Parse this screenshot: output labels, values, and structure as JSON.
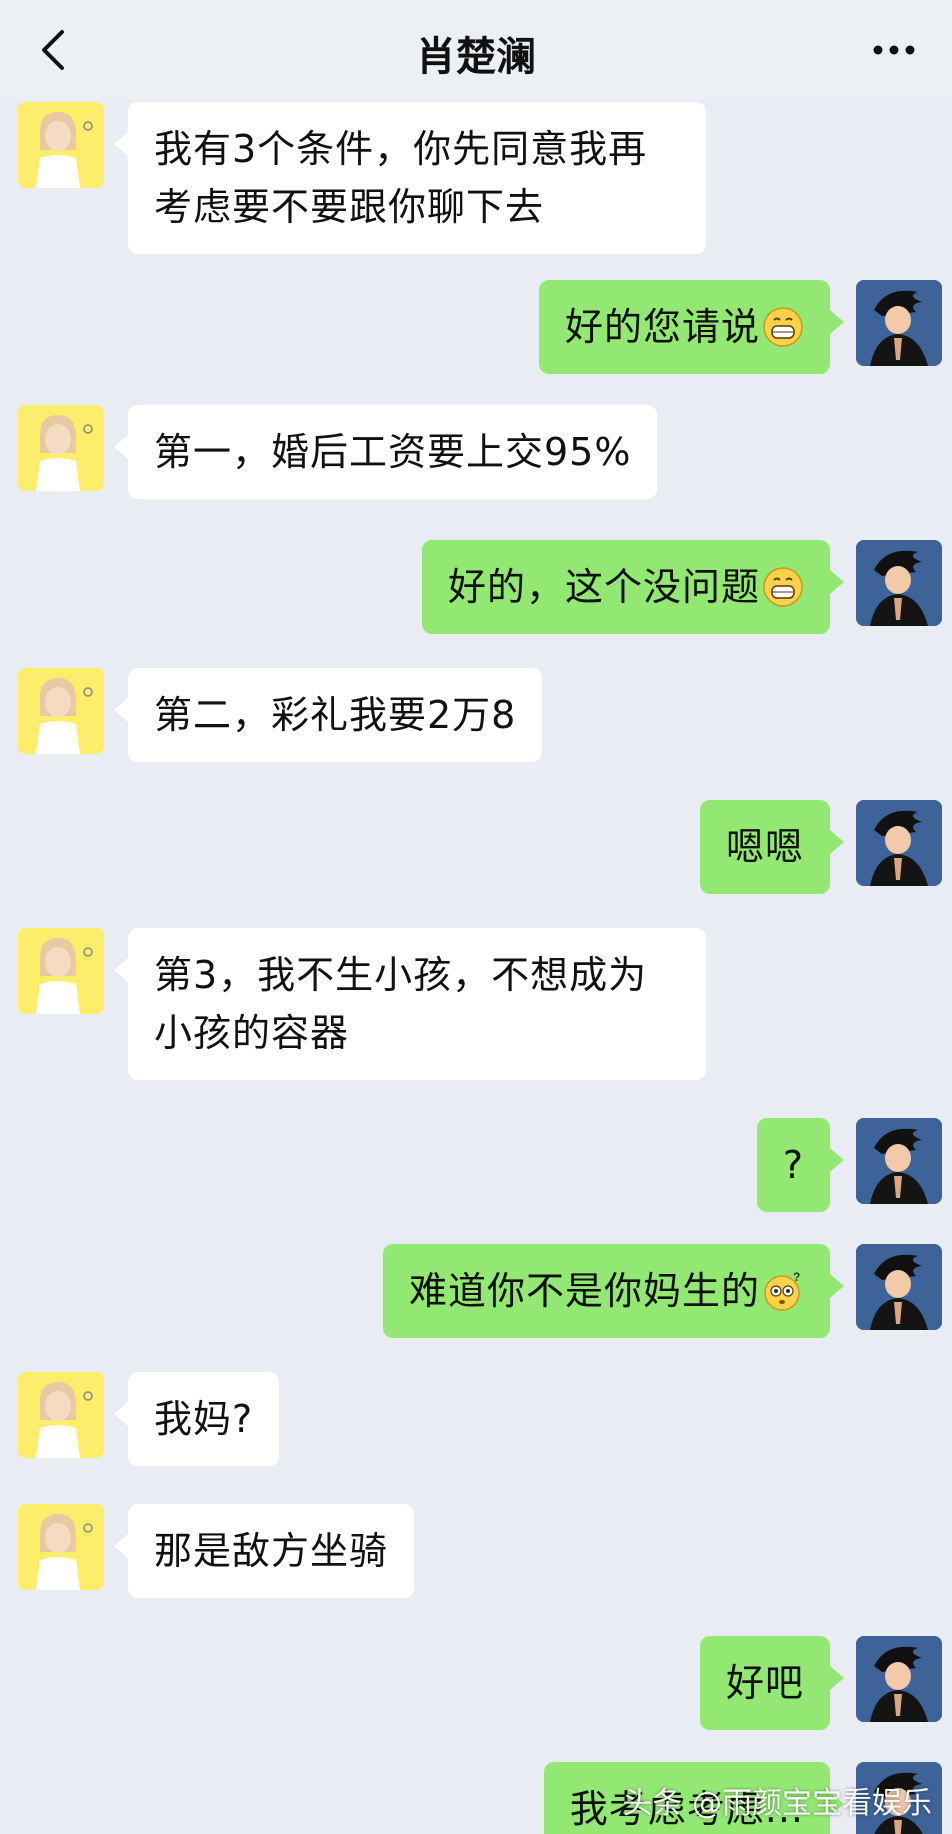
{
  "header": {
    "title": "肖楚澜",
    "back_icon": "chevron-left-icon",
    "more_icon": "more-dots-icon"
  },
  "messages": [
    {
      "side": "left",
      "text": "我有3个条件，你先同意我再考虑要不要跟你聊下去"
    },
    {
      "side": "right",
      "text": "好的您请说",
      "emoji": "grinning-face"
    },
    {
      "side": "left",
      "text": "第一，婚后工资要上交95%"
    },
    {
      "side": "right",
      "text": "好的，这个没问题",
      "emoji": "grinning-face"
    },
    {
      "side": "left",
      "text": "第二，彩礼我要2万8"
    },
    {
      "side": "right",
      "text": "嗯嗯"
    },
    {
      "side": "left",
      "text": "第3，我不生小孩，不想成为小孩的容器"
    },
    {
      "side": "right",
      "text": "?"
    },
    {
      "side": "right",
      "text": "难道你不是你妈生的",
      "emoji": "confused-face"
    },
    {
      "side": "left",
      "text": "我妈?"
    },
    {
      "side": "left",
      "text": "那是敌方坐骑"
    },
    {
      "side": "right",
      "text": "好吧"
    },
    {
      "side": "right",
      "text": "我考虑考虑..."
    }
  ],
  "watermark": "头条 @雨颜宝宝看娱乐",
  "colors": {
    "background": "#e9edf3",
    "self_bubble": "#92e873",
    "other_bubble": "#ffffff"
  }
}
